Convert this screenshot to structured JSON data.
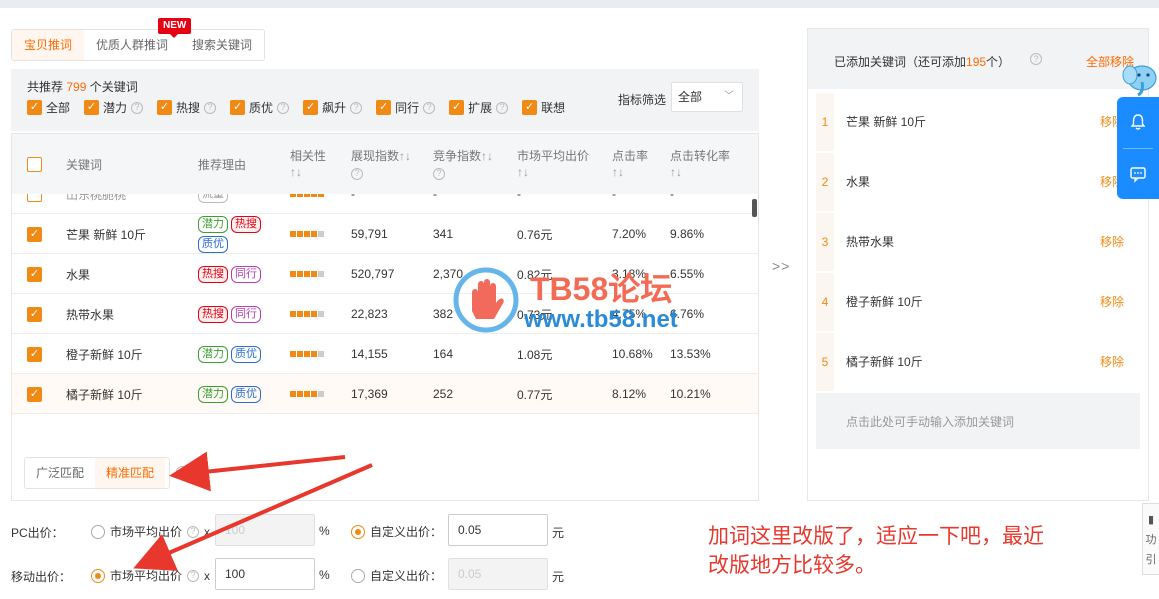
{
  "tabs": [
    {
      "label": "宝贝推词",
      "active": true
    },
    {
      "label": "优质人群推词",
      "active": false
    },
    {
      "label": "搜索关键词",
      "active": false
    }
  ],
  "new_badge": "NEW",
  "filter": {
    "summary_prefix": "共推荐",
    "summary_count": "799",
    "summary_suffix": "个关键词",
    "checkboxes": [
      "全部",
      "潜力",
      "热搜",
      "质优",
      "飙升",
      "同行",
      "扩展",
      "联想"
    ],
    "metric_label": "指标筛选",
    "metric_value": "全部"
  },
  "table": {
    "headers": {
      "keyword": "关键词",
      "reason": "推荐理由",
      "relevance": "相关性",
      "impressions": "展现指数",
      "competition": "竞争指数",
      "avg_bid": "市场平均出价",
      "ctr": "点击率",
      "cvr": "点击转化率"
    },
    "sort_glyph": "↑↓",
    "partial_row": {
      "keyword": "山东桃脆桃",
      "tag": "流量",
      "impressions": "-",
      "competition": "-",
      "avg_bid": "-",
      "ctr": "-",
      "cvr": "-"
    },
    "rows": [
      {
        "keyword": "芒果 新鲜 10斤",
        "tags": [
          {
            "t": "潜力",
            "c": "green"
          },
          {
            "t": "热搜",
            "c": "red"
          },
          {
            "t": "质优",
            "c": "blue"
          }
        ],
        "relevance": 4,
        "impressions": "59,791",
        "competition": "341",
        "avg_bid": "0.76元",
        "ctr": "7.20%",
        "cvr": "9.86%"
      },
      {
        "keyword": "水果",
        "tags": [
          {
            "t": "热搜",
            "c": "red"
          },
          {
            "t": "同行",
            "c": "purple"
          }
        ],
        "relevance": 4,
        "impressions": "520,797",
        "competition": "2,370",
        "avg_bid": "0.82元",
        "ctr": "3.18%",
        "cvr": "6.55%"
      },
      {
        "keyword": "热带水果",
        "tags": [
          {
            "t": "热搜",
            "c": "red"
          },
          {
            "t": "同行",
            "c": "purple"
          }
        ],
        "relevance": 4,
        "impressions": "22,823",
        "competition": "382",
        "avg_bid": "0.73元",
        "ctr": "4.75%",
        "cvr": "6.76%"
      },
      {
        "keyword": "橙子新鲜 10斤",
        "tags": [
          {
            "t": "潜力",
            "c": "green"
          },
          {
            "t": "质优",
            "c": "blue"
          }
        ],
        "relevance": 4,
        "impressions": "14,155",
        "competition": "164",
        "avg_bid": "1.08元",
        "ctr": "10.68%",
        "cvr": "13.53%"
      },
      {
        "keyword": "橘子新鲜 10斤",
        "tags": [
          {
            "t": "潜力",
            "c": "green"
          },
          {
            "t": "质优",
            "c": "blue"
          }
        ],
        "relevance": 4,
        "impressions": "17,369",
        "competition": "252",
        "avg_bid": "0.77元",
        "ctr": "8.12%",
        "cvr": "10.21%"
      }
    ]
  },
  "match": {
    "options": [
      "广泛匹配",
      "精准匹配"
    ],
    "active": 1
  },
  "transfer_glyph": ">>",
  "added": {
    "title_prefix": "已添加关键词（还可添加",
    "remaining": "195",
    "title_suffix": "个）",
    "clear_all": "全部移除",
    "remove_label": "移除",
    "items": [
      {
        "idx": "1",
        "keyword": "芒果 新鲜 10斤"
      },
      {
        "idx": "2",
        "keyword": "水果"
      },
      {
        "idx": "3",
        "keyword": "热带水果"
      },
      {
        "idx": "4",
        "keyword": "橙子新鲜 10斤"
      },
      {
        "idx": "5",
        "keyword": "橘子新鲜 10斤"
      }
    ],
    "manual_hint": "点击此处可手动输入添加关键词"
  },
  "bids": {
    "pc": {
      "label": "PC出价：",
      "market_label": "市场平均出价",
      "multiplier": "x",
      "market_value": "100",
      "percent": "%",
      "custom_label": "自定义出价：",
      "custom_value": "0.05",
      "yuan": "元",
      "selected": "custom"
    },
    "mobile": {
      "label": "移动出价：",
      "market_label": "市场平均出价",
      "multiplier": "x",
      "market_value": "100",
      "percent": "%",
      "custom_label": "自定义出价：",
      "custom_value": "0.05",
      "yuan": "元",
      "selected": "market"
    }
  },
  "annotation": {
    "line1": "加词这里改版了，适应一下吧，最近",
    "line2": "改版地方比较多。"
  },
  "watermark": {
    "line1": "TB58论坛",
    "line2": "www.tb58.net"
  },
  "edge_widget": {
    "line1": "功",
    "line2": "引"
  },
  "colors": {
    "accent": "#f08a14",
    "link": "#ff6a00",
    "float_bar": "#1a8cff",
    "annotation": "#e8372d"
  }
}
